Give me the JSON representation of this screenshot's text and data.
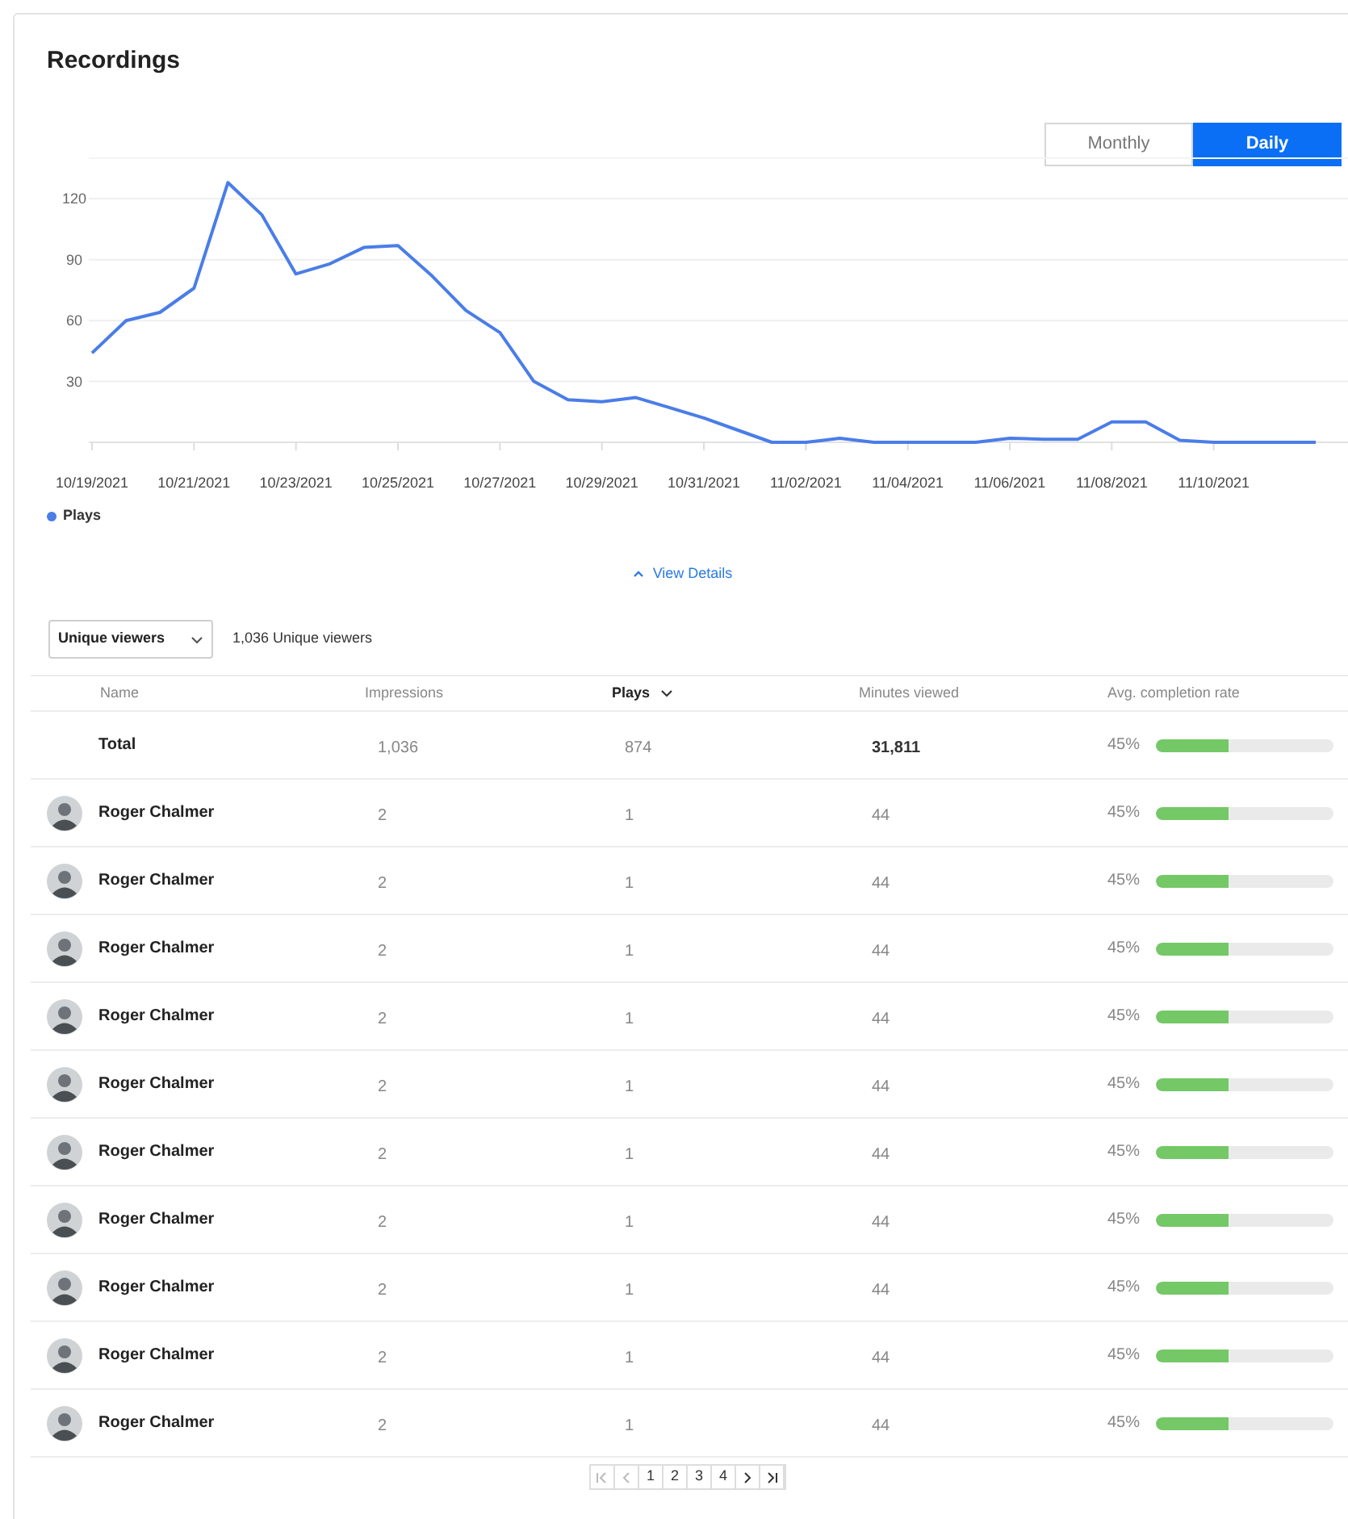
{
  "title": "Recordings",
  "period_toggle": [
    {
      "label": "Monthly",
      "selected": false
    },
    {
      "label": "Daily",
      "selected": true
    }
  ],
  "chart_data": {
    "type": "line",
    "categories": [
      "10/19/2021",
      null,
      null,
      "10/21/2021",
      null,
      null,
      "10/23/2021",
      null,
      null,
      "10/25/2021",
      null,
      null,
      "10/27/2021",
      null,
      null,
      "10/29/2021",
      null,
      null,
      "10/31/2021",
      null,
      null,
      "11/02/2021",
      null,
      null,
      "11/04/2021",
      null,
      null,
      "11/06/2021",
      null,
      null,
      "11/08/2021",
      null,
      null,
      "11/10/2021",
      null,
      null,
      null
    ],
    "series": [
      {
        "name": "Plays",
        "color": "#4a7de8",
        "values": [
          44,
          60,
          64,
          76,
          128,
          112,
          83,
          88,
          96,
          97,
          82,
          65,
          54,
          30,
          21,
          20,
          22,
          17,
          12,
          6,
          0,
          0,
          2,
          0,
          0,
          0,
          0,
          2,
          1.5,
          1.5,
          10,
          10,
          1,
          0,
          0,
          0,
          0
        ]
      }
    ],
    "grid": true,
    "ylim": [
      0,
      140
    ],
    "yticks": [
      {
        "value": 30,
        "label": "30"
      },
      {
        "value": 60,
        "label": "60"
      },
      {
        "value": 90,
        "label": "90"
      },
      {
        "value": 120,
        "label": "120"
      }
    ]
  },
  "view_details": "View Details",
  "viewer_select": {
    "value": "Unique viewers"
  },
  "viewer_count": "1,036 Unique viewers",
  "table": {
    "columns": [
      {
        "label": "Name",
        "sorted": false
      },
      {
        "label": "Impressions",
        "sorted": false
      },
      {
        "label": "Plays",
        "sorted": true
      },
      {
        "label": "Minutes viewed",
        "sorted": false
      },
      {
        "label": "Avg. completion rate",
        "sorted": false
      }
    ],
    "rows": [
      {
        "kind": "total",
        "name": "Total",
        "impressions": "1,036",
        "plays": "874",
        "minutes": "31,811",
        "rate": "45%",
        "level": 0.41
      },
      {
        "kind": "viewer",
        "name": "Roger Chalmer",
        "impressions": "2",
        "plays": "1",
        "minutes": "44",
        "rate": "45%",
        "level": 0.41
      },
      {
        "kind": "viewer",
        "name": "Roger Chalmer",
        "impressions": "2",
        "plays": "1",
        "minutes": "44",
        "rate": "45%",
        "level": 0.41
      },
      {
        "kind": "viewer",
        "name": "Roger Chalmer",
        "impressions": "2",
        "plays": "1",
        "minutes": "44",
        "rate": "45%",
        "level": 0.41
      },
      {
        "kind": "viewer",
        "name": "Roger Chalmer",
        "impressions": "2",
        "plays": "1",
        "minutes": "44",
        "rate": "45%",
        "level": 0.41
      },
      {
        "kind": "viewer",
        "name": "Roger Chalmer",
        "impressions": "2",
        "plays": "1",
        "minutes": "44",
        "rate": "45%",
        "level": 0.41
      },
      {
        "kind": "viewer",
        "name": "Roger Chalmer",
        "impressions": "2",
        "plays": "1",
        "minutes": "44",
        "rate": "45%",
        "level": 0.41
      },
      {
        "kind": "viewer",
        "name": "Roger Chalmer",
        "impressions": "2",
        "plays": "1",
        "minutes": "44",
        "rate": "45%",
        "level": 0.41
      },
      {
        "kind": "viewer",
        "name": "Roger Chalmer",
        "impressions": "2",
        "plays": "1",
        "minutes": "44",
        "rate": "45%",
        "level": 0.41
      },
      {
        "kind": "viewer",
        "name": "Roger Chalmer",
        "impressions": "2",
        "plays": "1",
        "minutes": "44",
        "rate": "45%",
        "level": 0.41
      },
      {
        "kind": "viewer",
        "name": "Roger Chalmer",
        "impressions": "2",
        "plays": "1",
        "minutes": "44",
        "rate": "45%",
        "level": 0.41
      }
    ]
  },
  "pagination": {
    "pages": [
      "1",
      "2",
      "3",
      "4"
    ]
  }
}
